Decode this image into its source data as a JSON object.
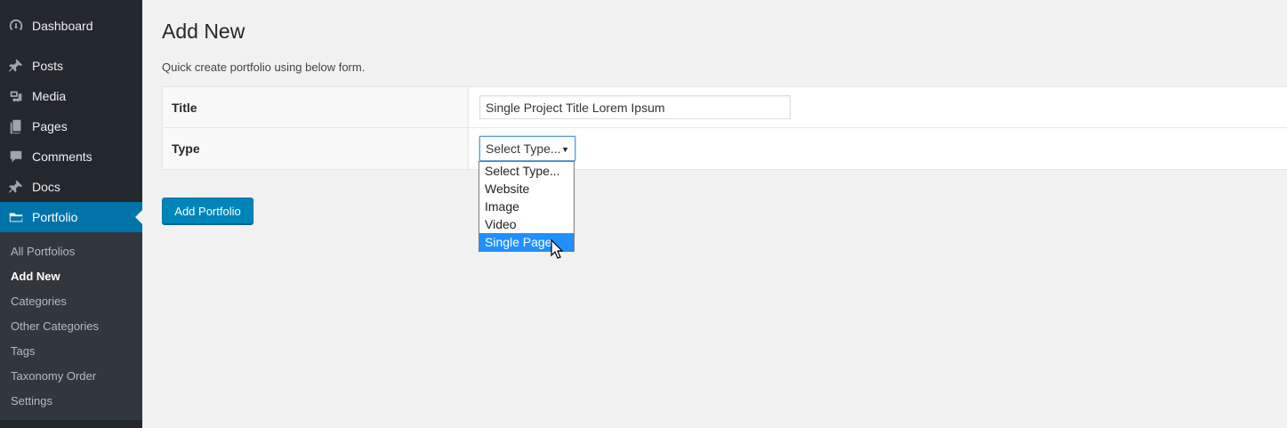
{
  "sidebar": {
    "items": [
      {
        "label": "Dashboard",
        "icon": "dashboard-icon"
      },
      {
        "label": "Posts",
        "icon": "pin-icon"
      },
      {
        "label": "Media",
        "icon": "media-icon"
      },
      {
        "label": "Pages",
        "icon": "pages-icon"
      },
      {
        "label": "Comments",
        "icon": "comments-icon"
      },
      {
        "label": "Docs",
        "icon": "pin-icon"
      },
      {
        "label": "Portfolio",
        "icon": "folder-icon"
      }
    ],
    "submenu": [
      {
        "label": "All Portfolios"
      },
      {
        "label": "Add New"
      },
      {
        "label": "Categories"
      },
      {
        "label": "Other Categories"
      },
      {
        "label": "Tags"
      },
      {
        "label": "Taxonomy Order"
      },
      {
        "label": "Settings"
      }
    ]
  },
  "main": {
    "title": "Add New",
    "intro": "Quick create portfolio using below form.",
    "form": {
      "title_label": "Title",
      "title_value": "Single Project Title Lorem Ipsum",
      "type_label": "Type",
      "type_selected": "Select Type...",
      "type_options": [
        "Select Type...",
        "Website",
        "Image",
        "Video",
        "Single Page"
      ],
      "highlighted_option": "Single Page"
    },
    "submit_label": "Add Portfolio"
  },
  "colors": {
    "sidebar_bg": "#23282d",
    "submenu_bg": "#32373c",
    "accent": "#0073aa",
    "button": "#0085ba",
    "highlight": "#1e90ff"
  }
}
